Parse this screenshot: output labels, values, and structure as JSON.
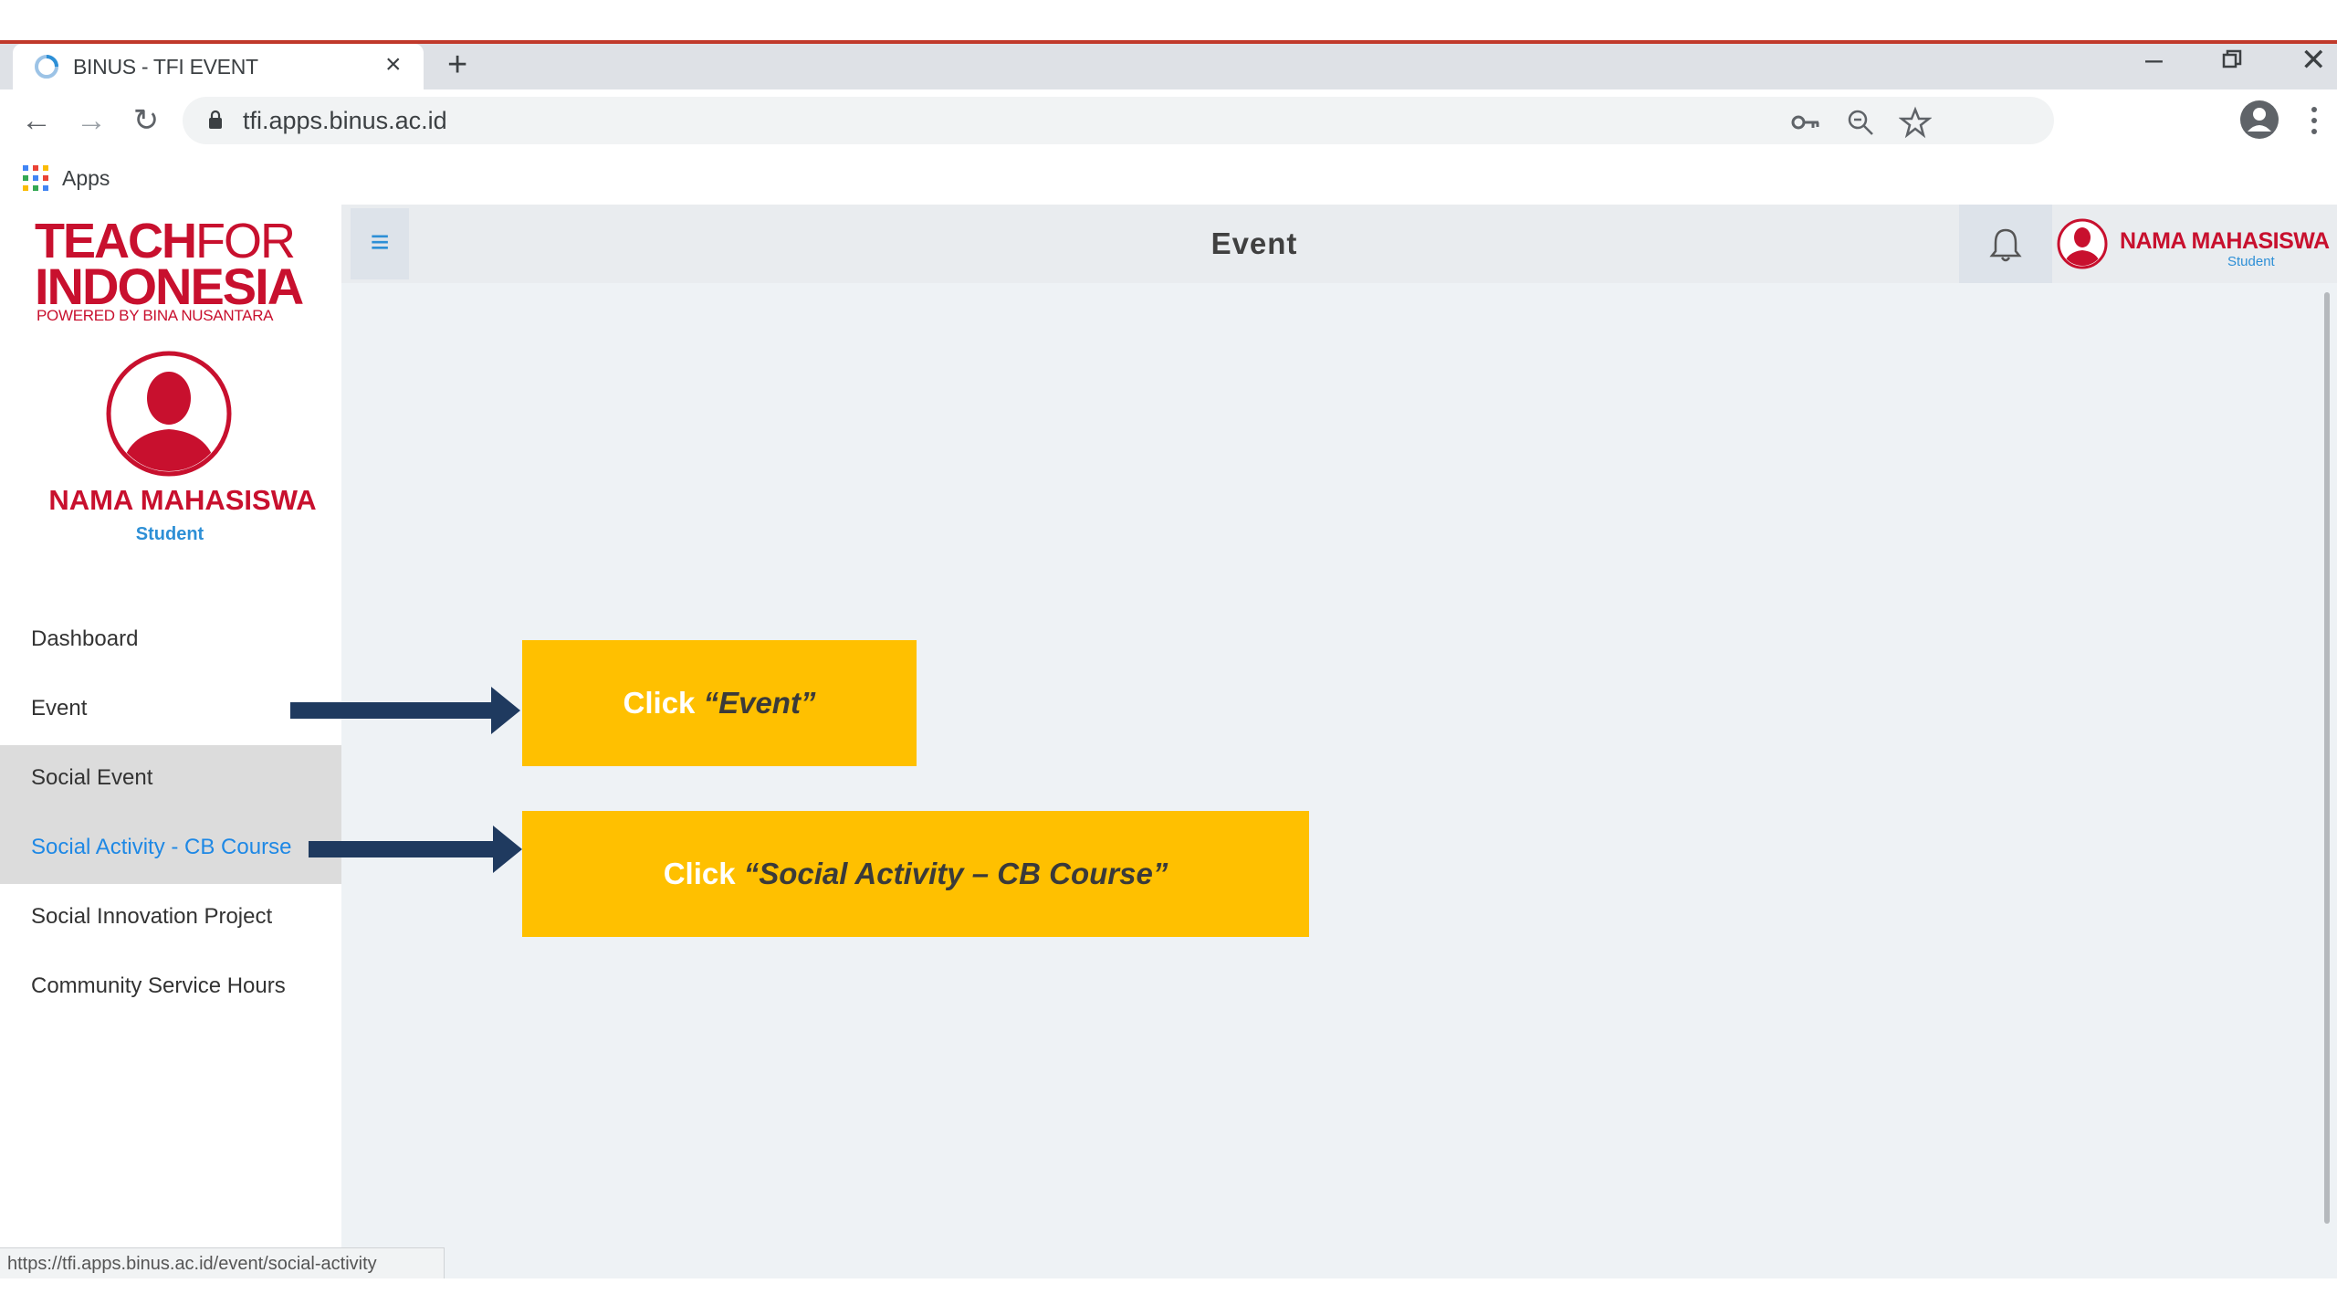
{
  "browser": {
    "tab_title": "BINUS - TFI EVENT",
    "new_tab_symbol": "+",
    "tab_close_symbol": "×",
    "url": "tfi.apps.binus.ac.id",
    "bookmarks_apps_label": "Apps",
    "status_url": "https://tfi.apps.binus.ac.id/event/social-activity"
  },
  "logo": {
    "line1_bold": "TEACH",
    "line1_light": "FOR",
    "line2": "INDONESIA",
    "line3": "POWERED BY BINA NUSANTARA"
  },
  "user": {
    "name": "NAMA MAHASISWA",
    "role": "Student"
  },
  "header": {
    "title": "Event"
  },
  "sidebar": {
    "items": [
      {
        "label": "Dashboard"
      },
      {
        "label": "Event"
      },
      {
        "label": "Social Event"
      },
      {
        "label": "Social Activity - CB Course"
      },
      {
        "label": "Social Innovation Project"
      },
      {
        "label": "Community Service Hours"
      }
    ]
  },
  "annotations": {
    "callout1_prefix": "Click ",
    "callout1_target": "“Event”",
    "callout2_prefix": "Click ",
    "callout2_target": "“Social Activity – CB Course”"
  },
  "colors": {
    "brand_red": "#c8102e",
    "accent_blue": "#2d8fd6",
    "callout_yellow": "#ffc000",
    "arrow_navy": "#1f3a5f"
  }
}
